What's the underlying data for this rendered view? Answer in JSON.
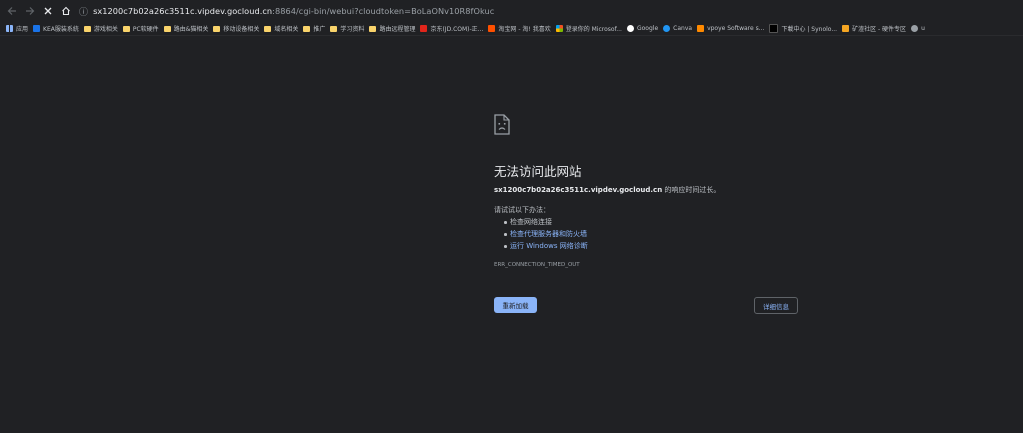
{
  "toolbar": {
    "back_icon": "arrow-left-icon",
    "forward_icon": "arrow-right-icon",
    "stop_icon": "close-icon",
    "home_icon": "home-icon",
    "url_host": "sx1200c7b02a26c3511c.vipdev.gocloud.cn",
    "url_path": ":8864/cgi-bin/webui?cloudtoken=BoLaONv10R8fOkuc"
  },
  "bookmarks": [
    {
      "label": "应用",
      "icon": "grid"
    },
    {
      "label": "KEA服装系統",
      "icon": "kea"
    },
    {
      "label": "游戏相关",
      "icon": "folder"
    },
    {
      "label": "PC软硬件",
      "icon": "folder"
    },
    {
      "label": "路由&猫相关",
      "icon": "folder"
    },
    {
      "label": "移动设备相关",
      "icon": "folder"
    },
    {
      "label": "域名相关",
      "icon": "folder"
    },
    {
      "label": "推广",
      "icon": "folder"
    },
    {
      "label": "学习资料",
      "icon": "folder"
    },
    {
      "label": "路由远程管理",
      "icon": "folder"
    },
    {
      "label": "京东(JD.COM)-正...",
      "icon": "jd"
    },
    {
      "label": "淘宝网 - 淘! 我喜欢",
      "icon": "tb"
    },
    {
      "label": "登录你的 Microsof...",
      "icon": "ms"
    },
    {
      "label": "Google",
      "icon": "goog"
    },
    {
      "label": "Canva",
      "icon": "canva"
    },
    {
      "label": "vpoye Software s...",
      "icon": "vpoye"
    },
    {
      "label": "下載中心 | Synolo...",
      "icon": "syn"
    },
    {
      "label": "矿渣社区 - 硬件专区",
      "icon": "kuang"
    },
    {
      "label": "u",
      "icon": "globe"
    }
  ],
  "error": {
    "icon": "sad-page-icon",
    "title": "无法访问此网站",
    "host": "sx1200c7b02a26c3511c.vipdev.gocloud.cn",
    "host_suffix": " 的响应时间过长。",
    "try_label": "请试试以下办法：",
    "suggestions": [
      "检查网络连接",
      "检查代理服务器和防火墙",
      "运行 Windows 网络诊断"
    ],
    "code": "ERR_CONNECTION_TIMED_OUT",
    "reload_label": "重新加载",
    "details_label": "详细信息"
  },
  "colors": {
    "background": "#202124",
    "link": "#8ab4f8",
    "primary_button": "#8ab4f8"
  }
}
